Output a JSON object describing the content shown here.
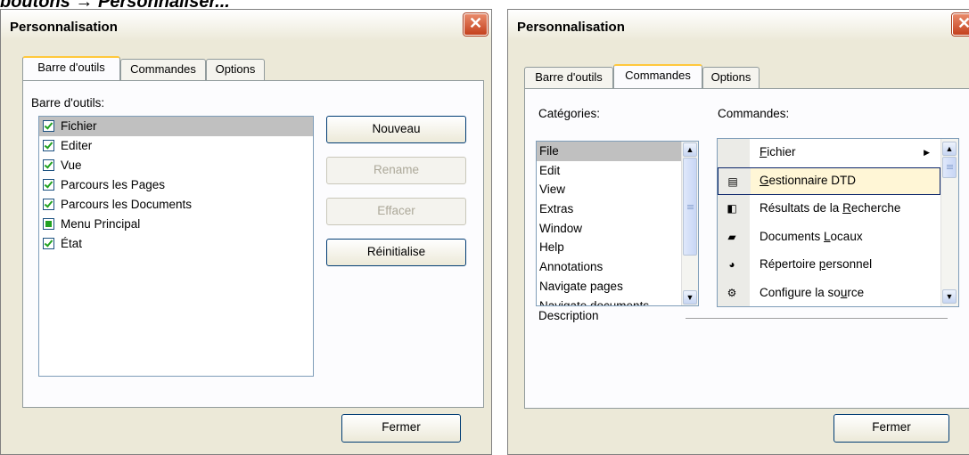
{
  "caption": "boutons → Personnaliser...",
  "dialog1": {
    "title": "Personnalisation",
    "tabs": [
      "Barre d'outils",
      "Commandes",
      "Options"
    ],
    "toolbars_label": "Barre d'outils:",
    "toolbars": [
      {
        "label": "Fichier",
        "state": "checked"
      },
      {
        "label": "Editer",
        "state": "checked"
      },
      {
        "label": "Vue",
        "state": "checked"
      },
      {
        "label": "Parcours les Pages",
        "state": "checked"
      },
      {
        "label": "Parcours les Documents",
        "state": "checked"
      },
      {
        "label": "Menu Principal",
        "state": "indeterminate"
      },
      {
        "label": "État",
        "state": "checked"
      }
    ],
    "buttons": {
      "new": "Nouveau",
      "rename": "Rename",
      "delete": "Effacer",
      "reset": "Réinitialise",
      "close": "Fermer"
    }
  },
  "dialog2": {
    "title": "Personnalisation",
    "tabs": [
      "Barre d'outils",
      "Commandes",
      "Options"
    ],
    "categories_label": "Catégories:",
    "commands_label": "Commandes:",
    "categories": [
      "File",
      "Edit",
      "View",
      "Extras",
      "Window",
      "Help",
      "Annotations",
      "Navigate pages",
      "Navigate documents"
    ],
    "commands": [
      {
        "pre": "",
        "ul": "F",
        "post": "ichier",
        "icon": "submenu",
        "has_arrow": true
      },
      {
        "pre": "",
        "ul": "G",
        "post": "estionnaire DTD",
        "icon": "dtd-manager-icon",
        "has_arrow": false
      },
      {
        "pre": "Résultats de la ",
        "ul": "R",
        "post": "echerche",
        "icon": "search-results-icon",
        "has_arrow": false
      },
      {
        "pre": "Documents ",
        "ul": "L",
        "post": "ocaux",
        "icon": "local-documents-icon",
        "has_arrow": false
      },
      {
        "pre": "Répertoire ",
        "ul": "p",
        "post": "ersonnel",
        "icon": "personal-directory-icon",
        "has_arrow": false
      },
      {
        "pre": "Configure la so",
        "ul": "u",
        "post": "rce",
        "icon": "configure-source-icon",
        "has_arrow": false
      }
    ],
    "description_label": "Description",
    "close": "Fermer"
  }
}
